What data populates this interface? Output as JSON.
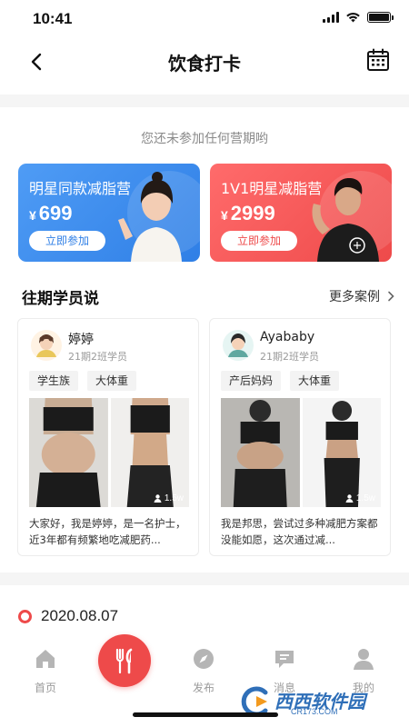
{
  "status": {
    "time": "10:41"
  },
  "nav": {
    "title": "饮食打卡"
  },
  "notice": "您还未参加任何营期哟",
  "camps": [
    {
      "title": "明星同款减脂营",
      "currency": "¥",
      "price": "699",
      "button": "立即参加",
      "color": "#2f7fe6"
    },
    {
      "title": "1V1明星减脂营",
      "currency": "¥",
      "price": "2999",
      "button": "立即参加",
      "color": "#ee4a4a"
    }
  ],
  "testimonials": {
    "title": "往期学员说",
    "more": "更多案例",
    "items": [
      {
        "name": "婷婷",
        "class": "21期2班学员",
        "tags": [
          "学生族",
          "大体重"
        ],
        "views": "1.5w",
        "text": "大家好，我是婷婷，是一名护士，近3年都有频繁地吃减肥药..."
      },
      {
        "name": "Ayababy",
        "class": "21期2班学员",
        "tags": [
          "产后妈妈",
          "大体重"
        ],
        "views": "1.5w",
        "text": "我是邦思，尝试过多种减肥方案都没能如愿，这次通过减..."
      }
    ]
  },
  "date": "2020.08.07",
  "tabs": [
    {
      "label": "首页",
      "icon": "home-icon"
    },
    {
      "label": "",
      "icon": "fork-knife-icon"
    },
    {
      "label": "发布",
      "icon": "compass-icon"
    },
    {
      "label": "消息",
      "icon": "message-icon"
    },
    {
      "label": "我的",
      "icon": "profile-icon"
    }
  ],
  "watermark": {
    "text": "西西软件园",
    "sub": "CR173.COM"
  },
  "colors": {
    "accent": "#ee4a4a",
    "blue": "#2f7fe6",
    "muted": "#9a9a9a"
  }
}
